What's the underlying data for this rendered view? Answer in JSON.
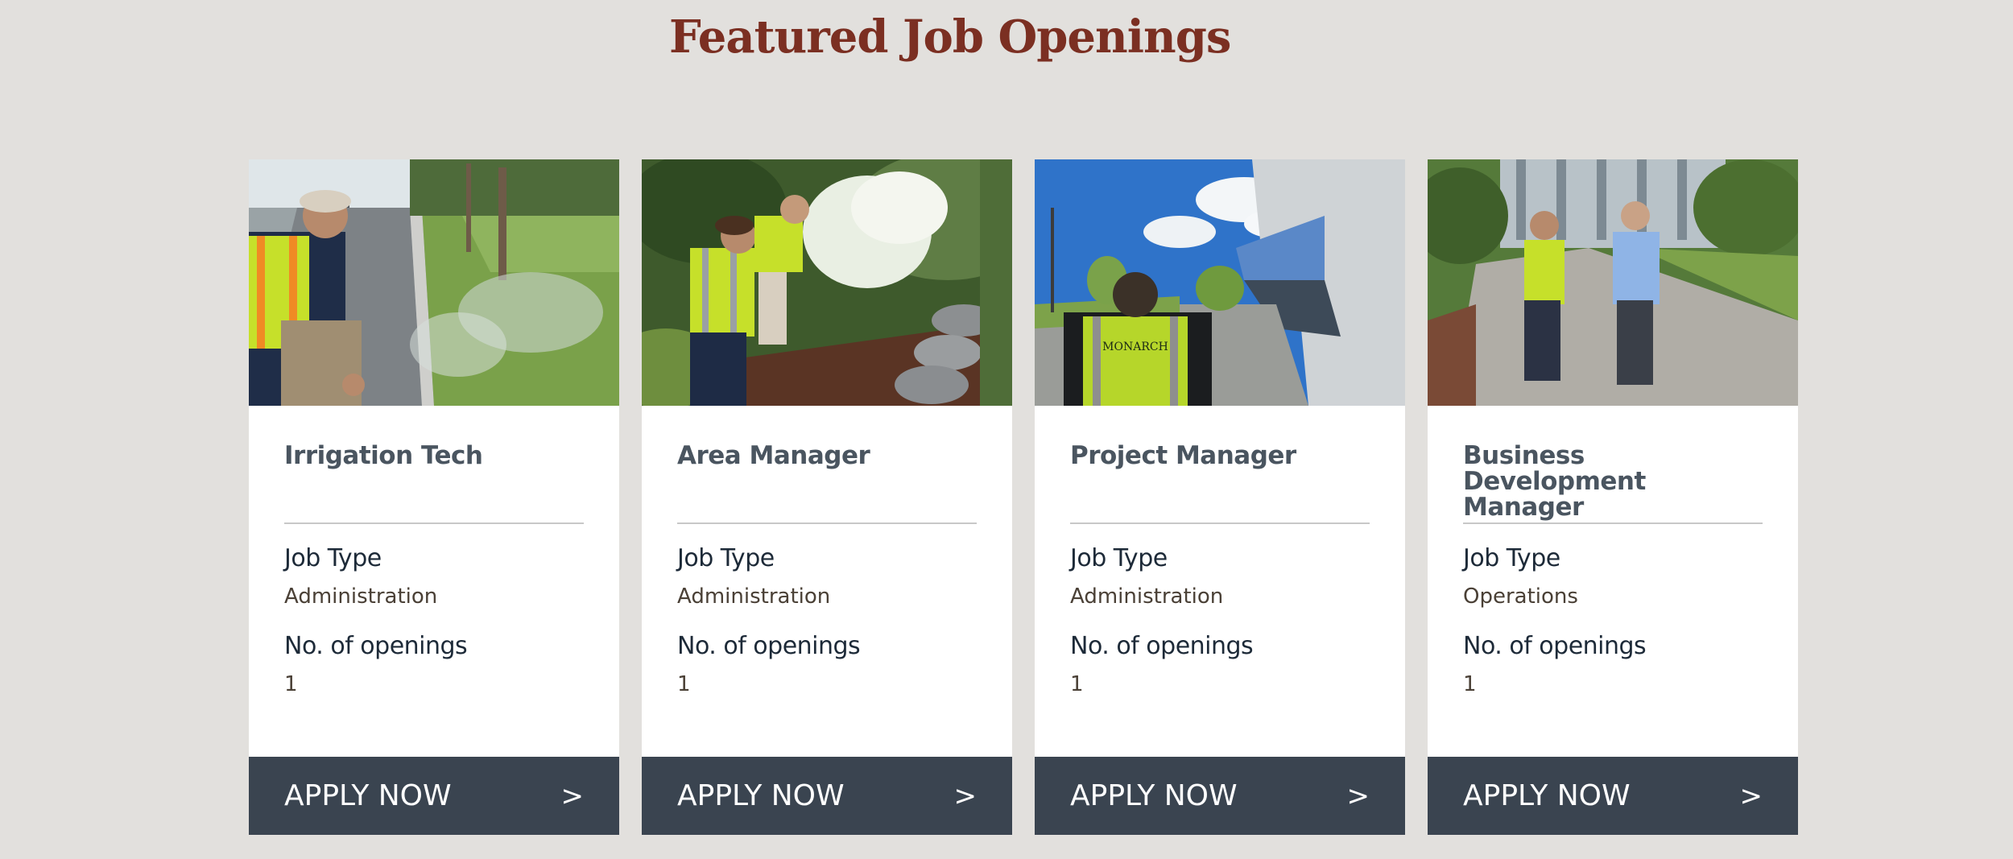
{
  "section": {
    "title": "Featured Job Openings"
  },
  "jobs": [
    {
      "title": "Irrigation Tech",
      "job_type_label": "Job Type",
      "job_type": "Administration",
      "openings_label": "No. of openings",
      "openings": "1",
      "apply_label": "APPLY NOW",
      "apply_arrow": ">",
      "photo": "worker-inspecting-sprinklers-photo"
    },
    {
      "title": "Area Manager",
      "job_type_label": "Job Type",
      "job_type": "Administration",
      "openings_label": "No. of openings",
      "openings": "1",
      "apply_label": "APPLY NOW",
      "apply_arrow": ">",
      "photo": "workers-in-garden-bed-photo"
    },
    {
      "title": "Project Manager",
      "job_type_label": "Job Type",
      "job_type": "Administration",
      "openings_label": "No. of openings",
      "openings": "1",
      "apply_label": "APPLY NOW",
      "apply_arrow": ">",
      "photo": "worker-at-modern-campus-photo"
    },
    {
      "title": "Business Development Manager",
      "job_type_label": "Job Type",
      "job_type": "Operations",
      "openings_label": "No. of openings",
      "openings": "1",
      "apply_label": "APPLY NOW",
      "apply_arrow": ">",
      "photo": "two-men-walking-campus-path-photo"
    }
  ],
  "colors": {
    "page_background": "#e2e0dd",
    "title": "#7b2f22",
    "button": "#3a4450",
    "job_title": "#4a5560",
    "hi_vis_vest": "#c8e62a"
  }
}
